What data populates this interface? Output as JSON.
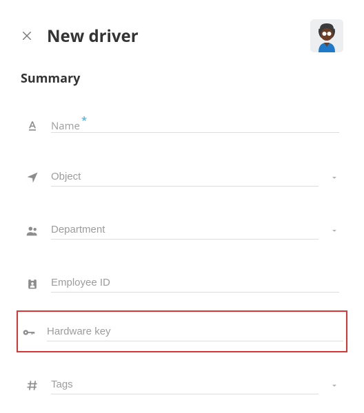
{
  "header": {
    "title": "New driver"
  },
  "section": {
    "title": "Summary"
  },
  "fields": {
    "name": {
      "label": "Name",
      "required_mark": "*"
    },
    "object": {
      "label": "Object"
    },
    "department": {
      "label": "Department"
    },
    "employee_id": {
      "label": "Employee ID"
    },
    "hardware_key": {
      "label": "Hardware key"
    },
    "tags": {
      "label": "Tags"
    }
  }
}
